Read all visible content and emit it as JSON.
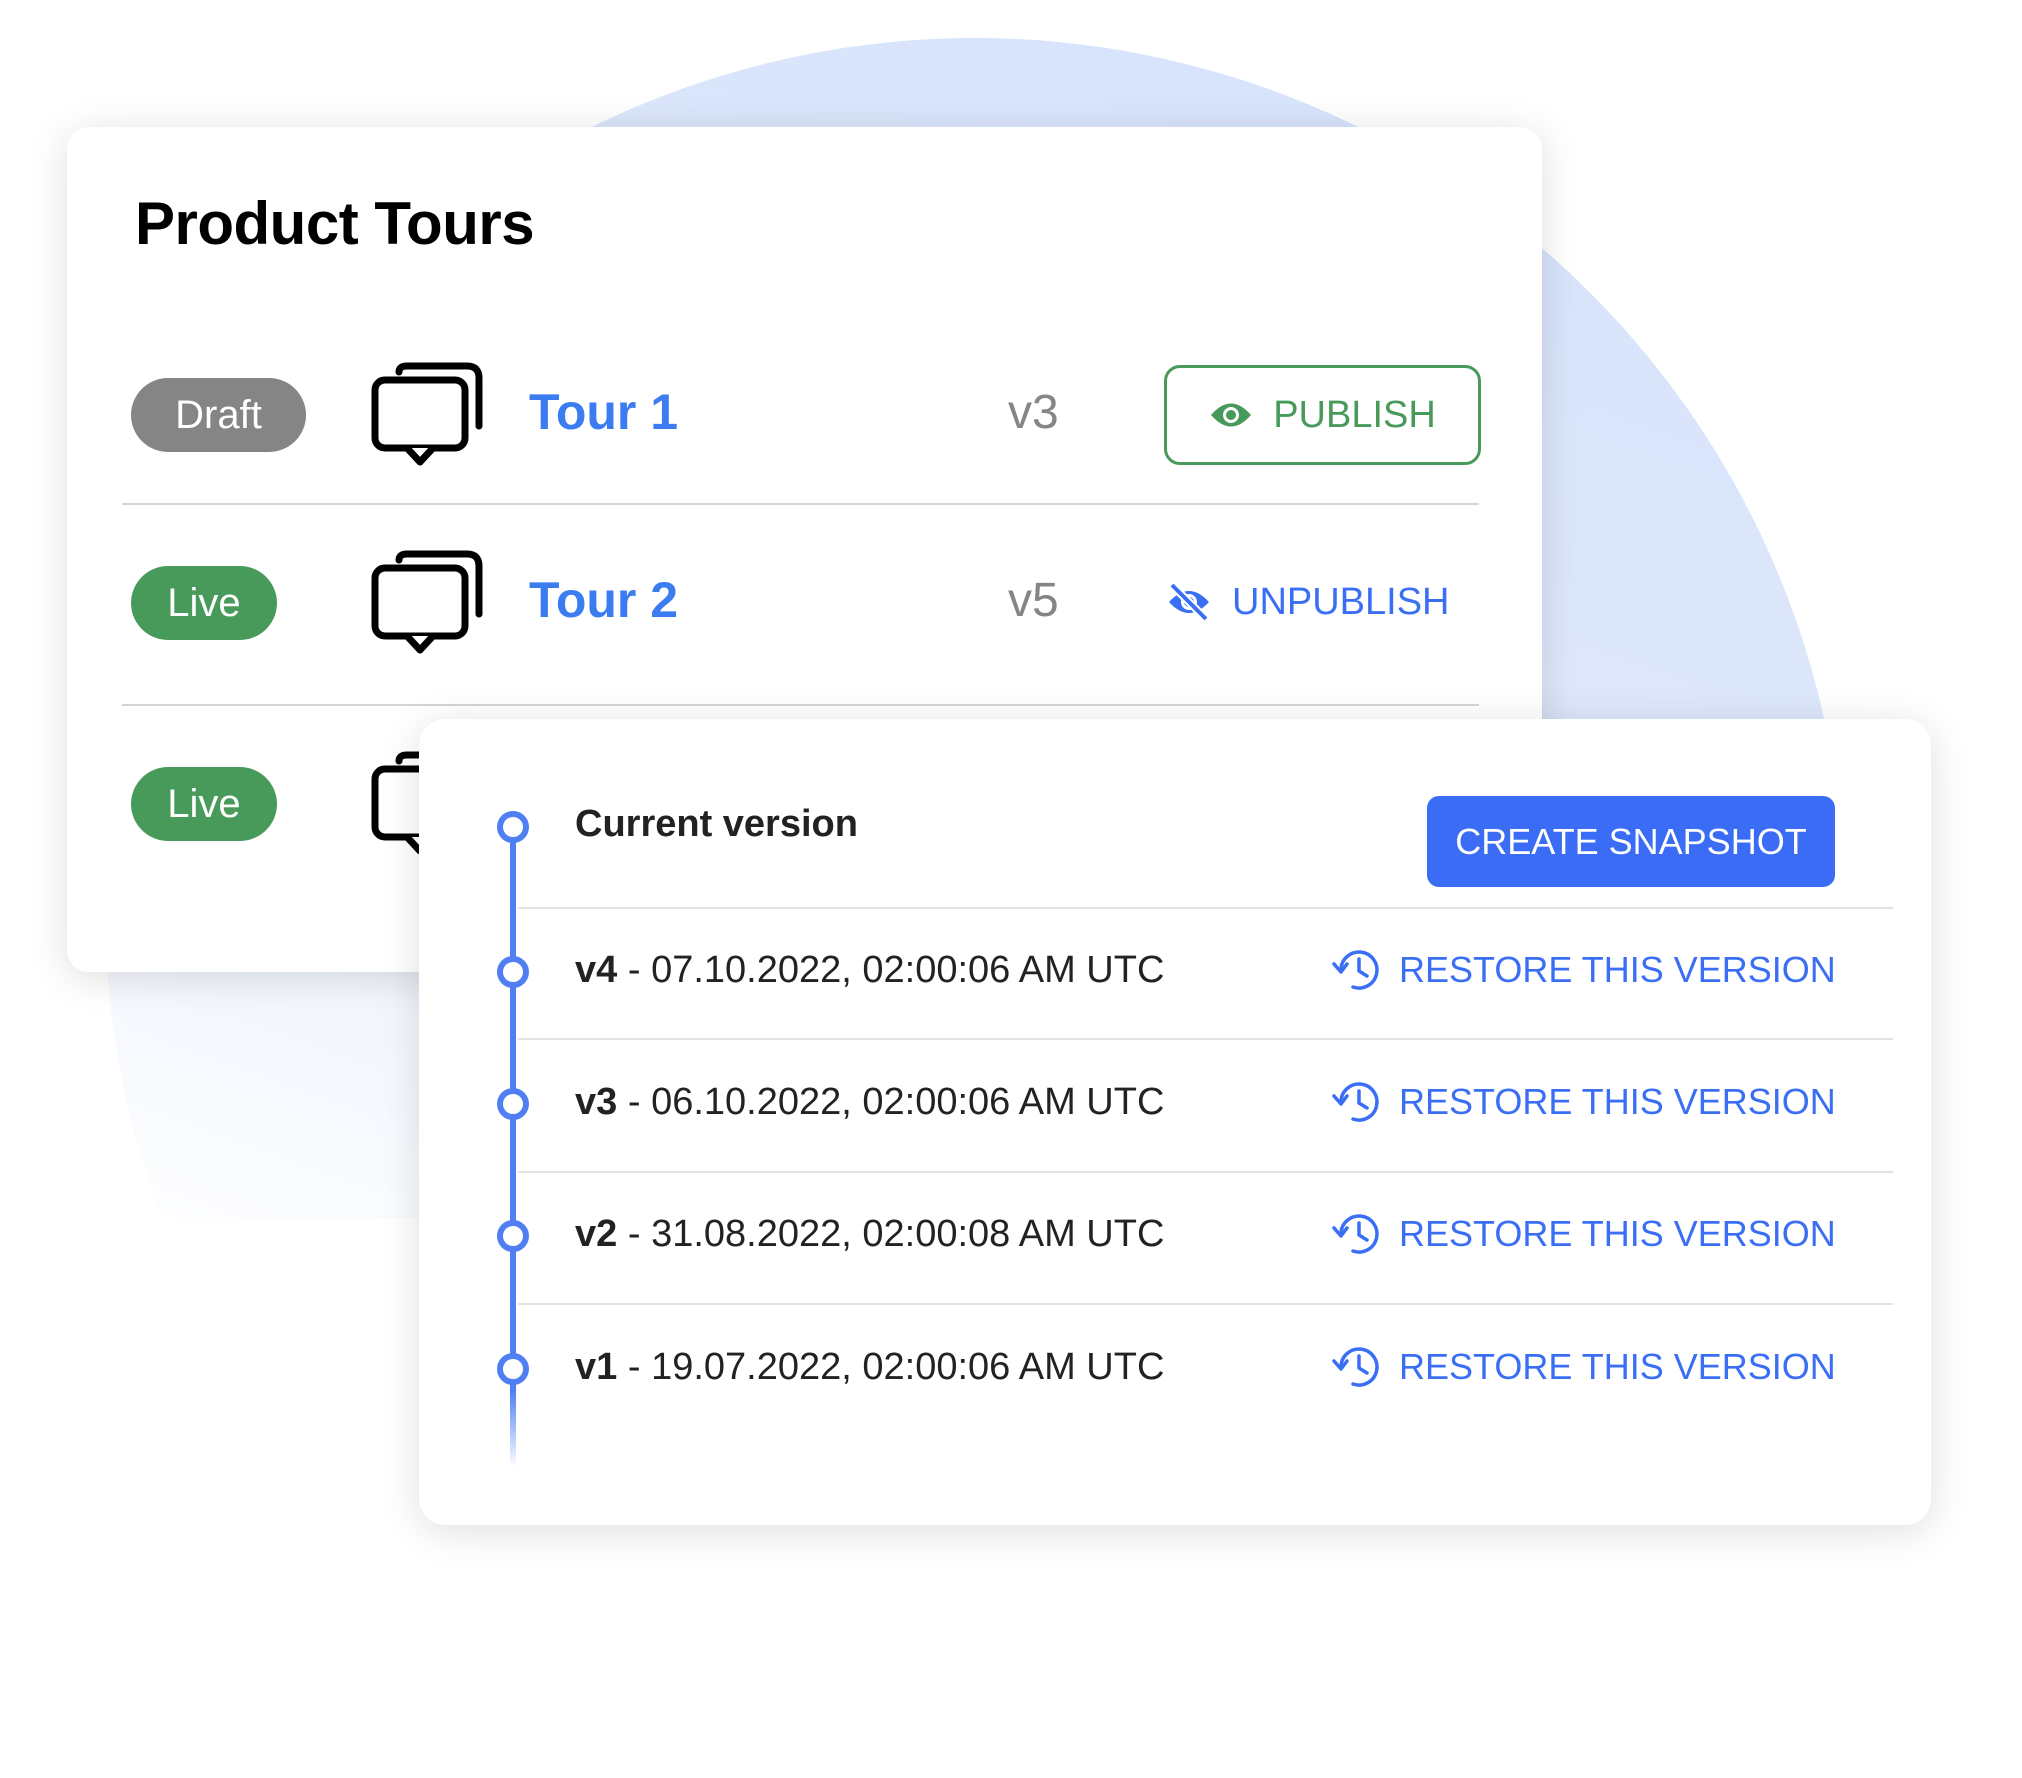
{
  "colors": {
    "accent_blue": "#3a6cf6",
    "live_green": "#489a5a",
    "draft_gray": "#858585",
    "tour_link_blue": "#3b7cf0"
  },
  "tours_panel": {
    "title": "Product Tours",
    "rows": [
      {
        "status": "Draft",
        "icon": "chat-bubbles-icon",
        "name": "Tour 1",
        "version": "v3",
        "action": {
          "label": "PUBLISH",
          "icon": "eye-icon"
        }
      },
      {
        "status": "Live",
        "icon": "chat-bubbles-icon",
        "name": "Tour 2",
        "version": "v5",
        "action": {
          "label": "UNPUBLISH",
          "icon": "eye-slash-icon"
        }
      },
      {
        "status": "Live",
        "icon": "chat-bubbles-icon"
      }
    ]
  },
  "versions_panel": {
    "current_label": "Current version",
    "create_snapshot_label": "CREATE SNAPSHOT",
    "versions": [
      {
        "id": "v4",
        "sep": " - ",
        "timestamp": "07.10.2022, 02:00:06 AM UTC",
        "restore_label": "RESTORE THIS VERSION"
      },
      {
        "id": "v3",
        "sep": " - ",
        "timestamp": "06.10.2022, 02:00:06 AM UTC",
        "restore_label": "RESTORE THIS VERSION"
      },
      {
        "id": "v2",
        "sep": " - ",
        "timestamp": "31.08.2022, 02:00:08 AM UTC",
        "restore_label": "RESTORE THIS VERSION"
      },
      {
        "id": "v1",
        "sep": " - ",
        "timestamp": "19.07.2022, 02:00:06 AM UTC",
        "restore_label": "RESTORE THIS VERSION"
      }
    ]
  }
}
